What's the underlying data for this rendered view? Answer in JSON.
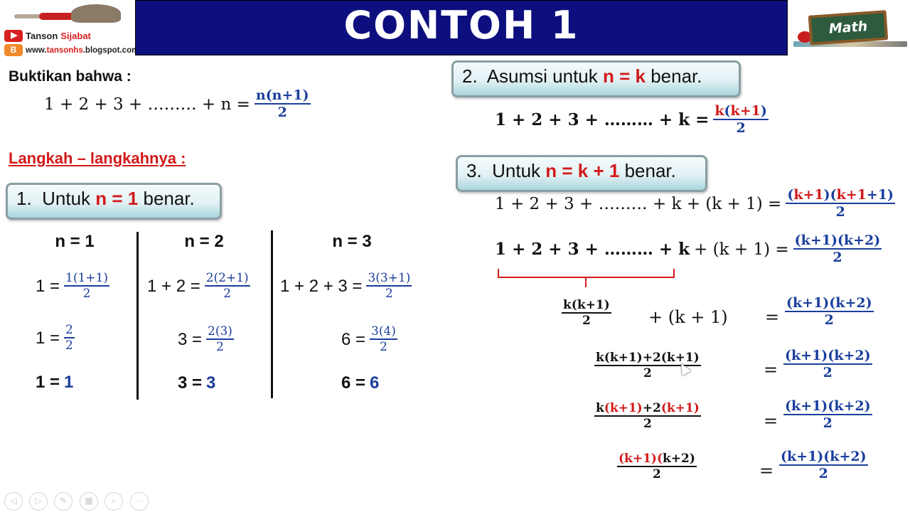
{
  "header": {
    "title": "CONTOH 1",
    "brand_name_first": "Tanson",
    "brand_name_second": "Sijabat",
    "brand_url_prefix": "www.",
    "brand_url_mid": "tansonhs",
    "brand_url_suffix": ".blogspot.com",
    "right_logo_text": "Math",
    "accent_color": "#0d0f7e"
  },
  "intro": {
    "prove_label": "Buktikan bahwa :",
    "formula_lhs": "1 + 2 + 3 + ……… + n =",
    "formula_num": "n(n+1)",
    "formula_den": "2",
    "steps_heading": "Langkah – langkahnya :"
  },
  "step1": {
    "prefix": "1.  Untuk ",
    "highlight": "n = 1",
    "suffix": " benar.",
    "columns": [
      {
        "head": "n = 1",
        "line1_lhs": "1 =",
        "line1_num": "1(1+1)",
        "line1_den": "2",
        "line2_lhs": "1 =",
        "line2_num": "2",
        "line2_den": "2",
        "line3_lhs": "1 =",
        "line3_rhs": "1"
      },
      {
        "head": "n = 2",
        "line1_lhs": "1 + 2 =",
        "line1_num": "2(2+1)",
        "line1_den": "2",
        "line2_lhs": "3 =",
        "line2_num": "2(3)",
        "line2_den": "2",
        "line3_lhs": "3 =",
        "line3_rhs": "3"
      },
      {
        "head": "n = 3",
        "line1_lhs": "1 + 2 + 3 =",
        "line1_num": "3(3+1)",
        "line1_den": "2",
        "line2_lhs": "6 =",
        "line2_num": "3(4)",
        "line2_den": "2",
        "line3_lhs": "6 =",
        "line3_rhs": "6"
      }
    ]
  },
  "step2": {
    "prefix": "2.  Asumsi untuk ",
    "highlight": "n = k",
    "suffix": " benar.",
    "formula_lhs": "1 + 2 + 3 + ……… + k =",
    "num_k": "k",
    "num_rest": "(k+1)",
    "den": "2"
  },
  "step3": {
    "prefix": "3.  Untuk ",
    "highlight": "n = k + 1",
    "suffix": " benar.",
    "line1": {
      "lhs": "1 + 2 + 3 + ……… + k + (k + 1) =",
      "num_p1": "(",
      "num_r1": "k+1",
      "num_p2": ")(",
      "num_r2": "k+1",
      "num_b2": "+1)",
      "den": "2"
    },
    "line2": {
      "lhs_bold": "1 + 2 + 3 + ……… + k",
      "lhs_rest": "+ (k + 1) =",
      "num": "(k+1)(k+2)",
      "den": "2"
    },
    "line3": {
      "frac_num": "k(k+1)",
      "frac_den": "2",
      "middle": "+ (k + 1)",
      "eq": "=",
      "num": "(k+1)(k+2)",
      "den": "2"
    },
    "line4": {
      "frac_num": "k(k+1)+2(k+1)",
      "frac_den": "2",
      "eq": "=",
      "num": "(k+1)(k+2)",
      "den": "2"
    },
    "line5": {
      "n_k": "k",
      "n_r1": "(k+1)",
      "n_mid": "+2",
      "n_r2": "(k+1)",
      "frac_den": "2",
      "eq": "=",
      "num": "(k+1)(k+2)",
      "den": "2"
    },
    "line6": {
      "n_r1": "(k+1)(",
      "n_b": "k+2)",
      "frac_den": "2",
      "eq": "=",
      "num": "(k+1)(k+2)",
      "den": "2"
    }
  },
  "colors": {
    "highlight_red": "#d21a1a",
    "formula_blue": "#1a3e9c",
    "step_box_border": "#8a9ea3"
  },
  "nav": {
    "icons": [
      "previous-icon",
      "next-icon",
      "pen-icon",
      "slides-icon",
      "zoom-icon",
      "more-icon"
    ],
    "glyphs": [
      "◁",
      "▷",
      "✎",
      "▦",
      "⌕",
      "···"
    ]
  }
}
